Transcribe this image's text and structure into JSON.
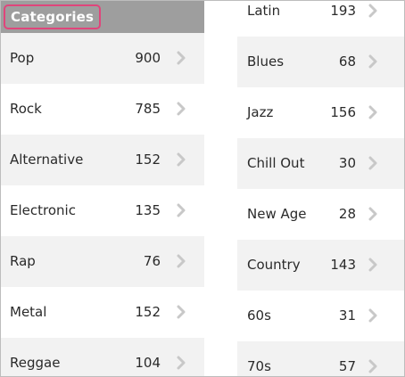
{
  "header": {
    "title": "Categories"
  },
  "left_column": [
    {
      "label": "Pop",
      "count": "900"
    },
    {
      "label": "Rock",
      "count": "785"
    },
    {
      "label": "Alternative",
      "count": "152"
    },
    {
      "label": "Electronic",
      "count": "135"
    },
    {
      "label": "Rap",
      "count": "76"
    },
    {
      "label": "Metal",
      "count": "152"
    },
    {
      "label": "Reggae",
      "count": "104"
    }
  ],
  "right_column": [
    {
      "label": "Latin",
      "count": "193"
    },
    {
      "label": "Blues",
      "count": "68"
    },
    {
      "label": "Jazz",
      "count": "156"
    },
    {
      "label": "Chill Out",
      "count": "30"
    },
    {
      "label": "New Age",
      "count": "28"
    },
    {
      "label": "Country",
      "count": "143"
    },
    {
      "label": "60s",
      "count": "31"
    },
    {
      "label": "70s",
      "count": "57"
    }
  ],
  "icons": {
    "row_arrow": "chevron-right-icon"
  },
  "colors": {
    "header_bg": "#9e9e9e",
    "title_border": "#e0457b",
    "row_alt_bg": "#f2f2f2",
    "chevron": "#c8c8c8"
  }
}
